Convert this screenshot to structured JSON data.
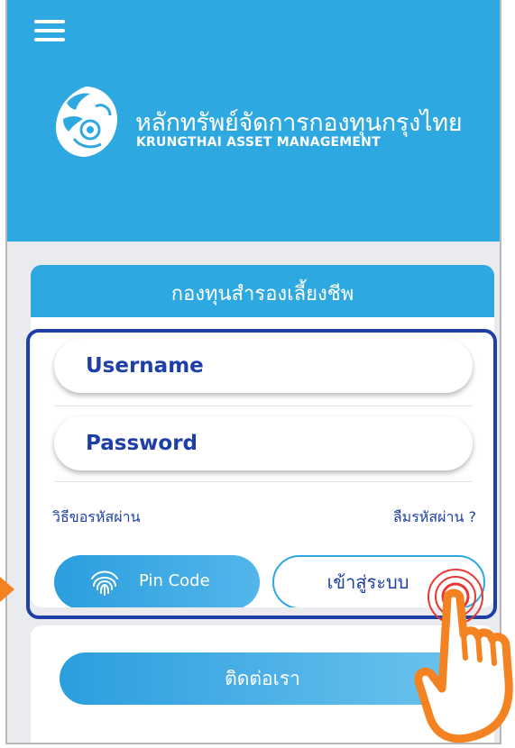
{
  "header": {
    "menu_icon": "hamburger-menu-icon",
    "logo_icon": "garuda-logo-icon",
    "brand_th": "หลักทรัพย์จัดการกองทุนกรุงไทย",
    "brand_en": "KRUNGTHAI ASSET MANAGEMENT"
  },
  "login_card": {
    "title": "กองทุนสำรองเลี้ยงชีพ",
    "username_placeholder": "Username",
    "password_placeholder": "Password",
    "help_link": "วิธีขอรหัสผ่าน",
    "forgot_link": "ลืมรหัสผ่าน ?",
    "pin_button": "Pin Code",
    "pin_icon": "fingerprint-icon",
    "login_button": "เข้าสู่ระบบ"
  },
  "contact": {
    "button": "ติดต่อเรา"
  },
  "annotation": {
    "highlight_color": "#1d3fa6",
    "arrow_color": "#f58220",
    "tap_color": "#e53935",
    "pointer_icon": "pointing-hand-icon"
  },
  "colors": {
    "primary": "#2ea8e1",
    "text_blue": "#1d3fa6",
    "background": "#e9ebee"
  }
}
